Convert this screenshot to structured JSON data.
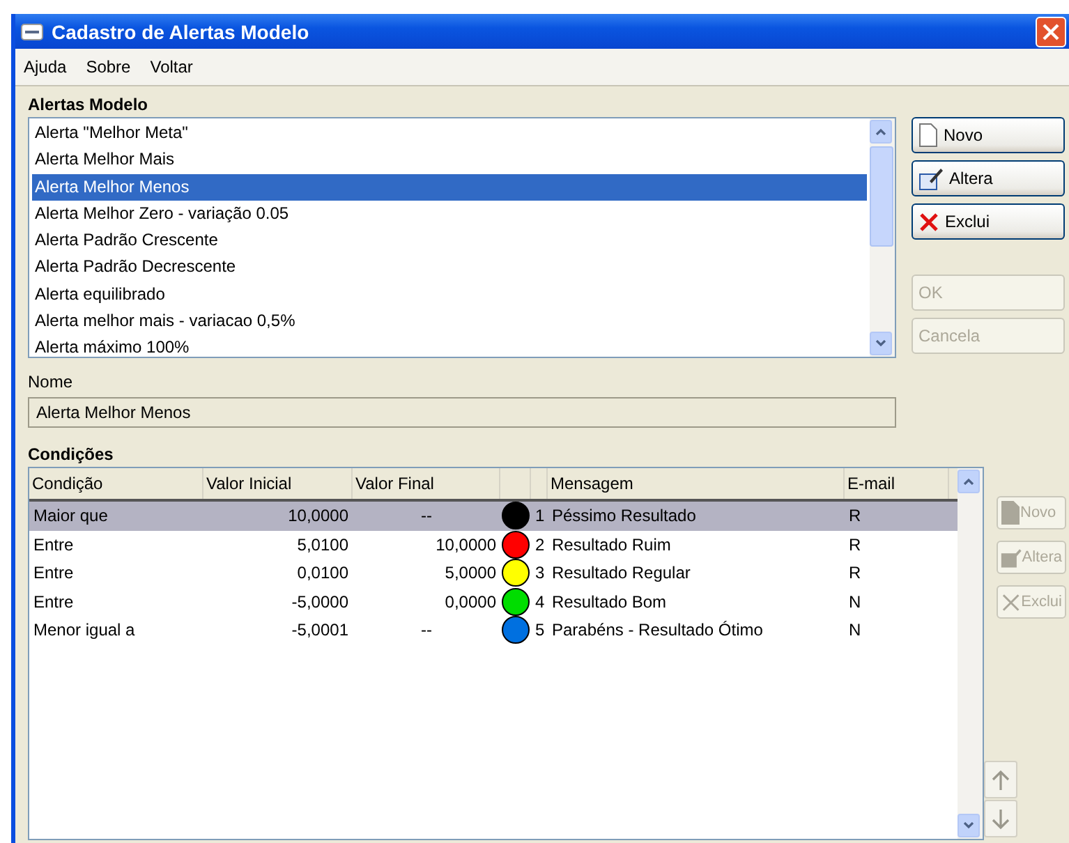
{
  "window": {
    "title": "Cadastro de Alertas Modelo"
  },
  "menu": [
    "Ajuda",
    "Sobre",
    "Voltar"
  ],
  "alerts": {
    "label": "Alertas Modelo",
    "items": [
      {
        "text": "Alerta \"Melhor Meta\"",
        "selected": false
      },
      {
        "text": "Alerta Melhor Mais",
        "selected": false
      },
      {
        "text": "Alerta Melhor Menos",
        "selected": true
      },
      {
        "text": "Alerta Melhor Zero - variação 0.05",
        "selected": false
      },
      {
        "text": "Alerta Padrão Crescente",
        "selected": false
      },
      {
        "text": "Alerta Padrão Decrescente",
        "selected": false
      },
      {
        "text": "Alerta equilibrado",
        "selected": false
      },
      {
        "text": "Alerta melhor mais - variacao 0,5%",
        "selected": false
      },
      {
        "text": "Alerta máximo 100%",
        "selected": false
      }
    ]
  },
  "alert_buttons": [
    {
      "label": "Novo",
      "kind": "new",
      "disabled": false
    },
    {
      "label": "Altera",
      "kind": "edit",
      "disabled": false
    },
    {
      "label": "Exclui",
      "kind": "delete",
      "disabled": false
    },
    {
      "label": "OK",
      "kind": "none",
      "disabled": true
    },
    {
      "label": "Cancela",
      "kind": "none",
      "disabled": true
    }
  ],
  "name_field": {
    "label": "Nome",
    "value": "Alerta Melhor Menos"
  },
  "conditions": {
    "label": "Condições",
    "columns": [
      "Condição",
      "Valor Inicial",
      "Valor Final",
      "Mensagem",
      "E-mail"
    ],
    "rows": [
      {
        "condition": "Maior que",
        "initial": "10,0000",
        "final": "--",
        "color": "#000000",
        "number": "1",
        "message": "Péssimo Resultado",
        "email": "R",
        "selected": true
      },
      {
        "condition": "Entre",
        "initial": "5,0100",
        "final": "10,0000",
        "color": "#ff0000",
        "number": "2",
        "message": "Resultado Ruim",
        "email": "R",
        "selected": false
      },
      {
        "condition": "Entre",
        "initial": "0,0100",
        "final": "5,0000",
        "color": "#ffff00",
        "number": "3",
        "message": "Resultado Regular",
        "email": "R",
        "selected": false
      },
      {
        "condition": "Entre",
        "initial": "-5,0000",
        "final": "0,0000",
        "color": "#00dd00",
        "number": "4",
        "message": "Resultado Bom",
        "email": "N",
        "selected": false
      },
      {
        "condition": "Menor igual a",
        "initial": "-5,0001",
        "final": "--",
        "color": "#0070e0",
        "number": "5",
        "message": "Parabéns - Resultado Ótimo",
        "email": "N",
        "selected": false
      }
    ]
  },
  "condition_buttons": [
    {
      "label": "Novo",
      "kind": "new",
      "disabled": true
    },
    {
      "label": "Altera",
      "kind": "edit",
      "disabled": true
    },
    {
      "label": "Exclui",
      "kind": "delete",
      "disabled": true
    }
  ]
}
